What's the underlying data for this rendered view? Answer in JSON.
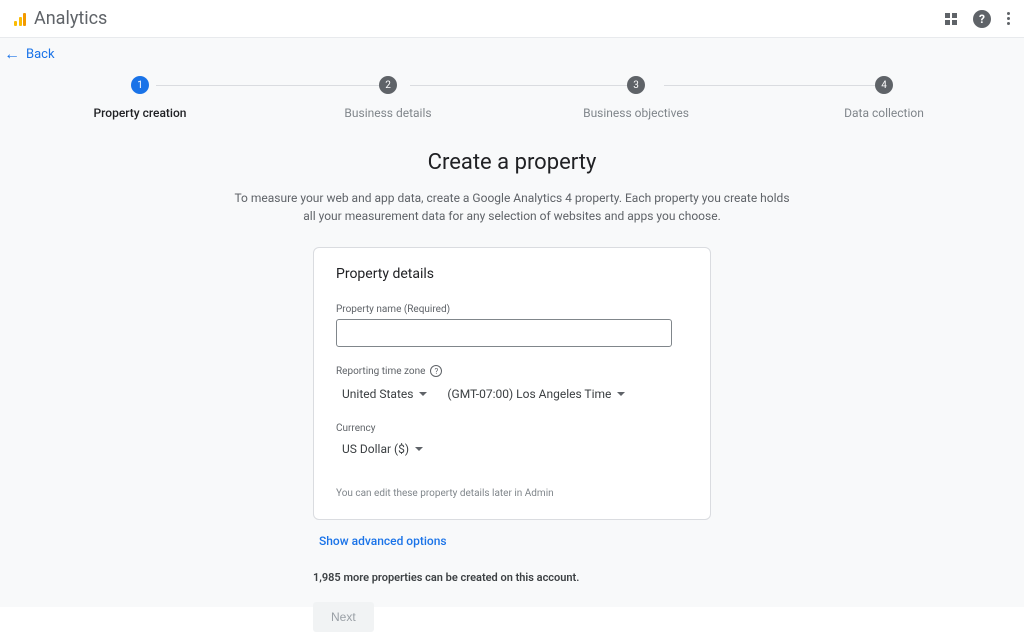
{
  "header": {
    "title": "Analytics"
  },
  "back": {
    "label": "Back"
  },
  "stepper": {
    "steps": [
      {
        "num": "1",
        "label": "Property creation"
      },
      {
        "num": "2",
        "label": "Business details"
      },
      {
        "num": "3",
        "label": "Business objectives"
      },
      {
        "num": "4",
        "label": "Data collection"
      }
    ]
  },
  "page": {
    "title": "Create a property",
    "description": "To measure your web and app data, create a Google Analytics 4 property. Each property you create holds all your measurement data for any selection of websites and apps you choose."
  },
  "card": {
    "title": "Property details",
    "property_name_label": "Property name (Required)",
    "timezone_label": "Reporting time zone",
    "country": "United States",
    "tz": "(GMT-07:00) Los Angeles Time",
    "currency_label": "Currency",
    "currency": "US Dollar ($)",
    "note": "You can edit these property details later in Admin"
  },
  "advanced_link": "Show advanced options",
  "properties_note": "1,985 more properties can be created on this account.",
  "next_button": "Next"
}
